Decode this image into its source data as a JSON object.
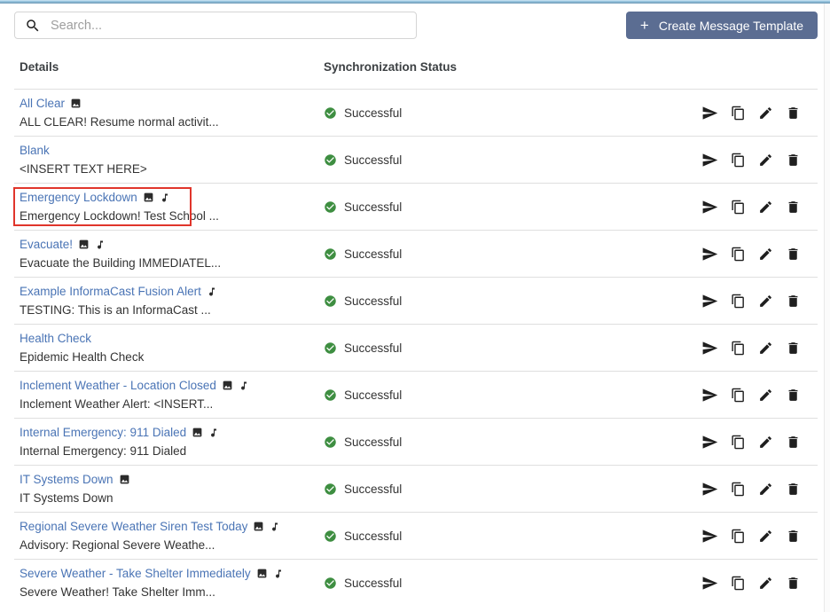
{
  "colors": {
    "link_blue": "#4a74b5",
    "button_bg": "#5b6d92",
    "status_green": "#3e8e41",
    "highlight_red": "#e0352b"
  },
  "toolbar": {
    "search_placeholder": "Search...",
    "search_value": "",
    "plus_icon": "+",
    "create_button_label": "Create Message Template"
  },
  "table": {
    "columns": [
      "Details",
      "Synchronization Status"
    ],
    "row_action_icons": [
      "send-icon",
      "copy-icon",
      "edit-icon",
      "delete-icon"
    ],
    "rows": [
      {
        "title": "All Clear",
        "subtitle": "ALL CLEAR! Resume normal activit...",
        "has_image_icon": true,
        "has_audio_icon": false,
        "status": "Successful",
        "highlighted": false
      },
      {
        "title": "Blank",
        "subtitle": "<INSERT TEXT HERE>",
        "has_image_icon": false,
        "has_audio_icon": false,
        "status": "Successful",
        "highlighted": false
      },
      {
        "title": "Emergency Lockdown",
        "subtitle": "Emergency Lockdown! Test School ...",
        "has_image_icon": true,
        "has_audio_icon": true,
        "status": "Successful",
        "highlighted": true
      },
      {
        "title": "Evacuate!",
        "subtitle": "Evacuate the Building IMMEDIATEL...",
        "has_image_icon": true,
        "has_audio_icon": true,
        "status": "Successful",
        "highlighted": false
      },
      {
        "title": "Example InformaCast Fusion Alert",
        "subtitle": "TESTING: This is an InformaCast ...",
        "has_image_icon": false,
        "has_audio_icon": true,
        "status": "Successful",
        "highlighted": false
      },
      {
        "title": "Health Check",
        "subtitle": "Epidemic Health Check",
        "has_image_icon": false,
        "has_audio_icon": false,
        "status": "Successful",
        "highlighted": false
      },
      {
        "title": "Inclement Weather - Location Closed",
        "subtitle": "Inclement Weather Alert: <INSERT...",
        "has_image_icon": true,
        "has_audio_icon": true,
        "status": "Successful",
        "highlighted": false
      },
      {
        "title": "Internal Emergency: 911 Dialed",
        "subtitle": "Internal Emergency: 911 Dialed",
        "has_image_icon": true,
        "has_audio_icon": true,
        "status": "Successful",
        "highlighted": false
      },
      {
        "title": "IT Systems Down",
        "subtitle": "IT Systems Down",
        "has_image_icon": true,
        "has_audio_icon": false,
        "status": "Successful",
        "highlighted": false
      },
      {
        "title": "Regional Severe Weather Siren Test Today",
        "subtitle": "Advisory: Regional Severe Weathe...",
        "has_image_icon": true,
        "has_audio_icon": true,
        "status": "Successful",
        "highlighted": false
      },
      {
        "title": "Severe Weather - Take Shelter Immediately",
        "subtitle": "Severe Weather! Take Shelter Imm...",
        "has_image_icon": true,
        "has_audio_icon": true,
        "status": "Successful",
        "highlighted": false
      }
    ]
  }
}
